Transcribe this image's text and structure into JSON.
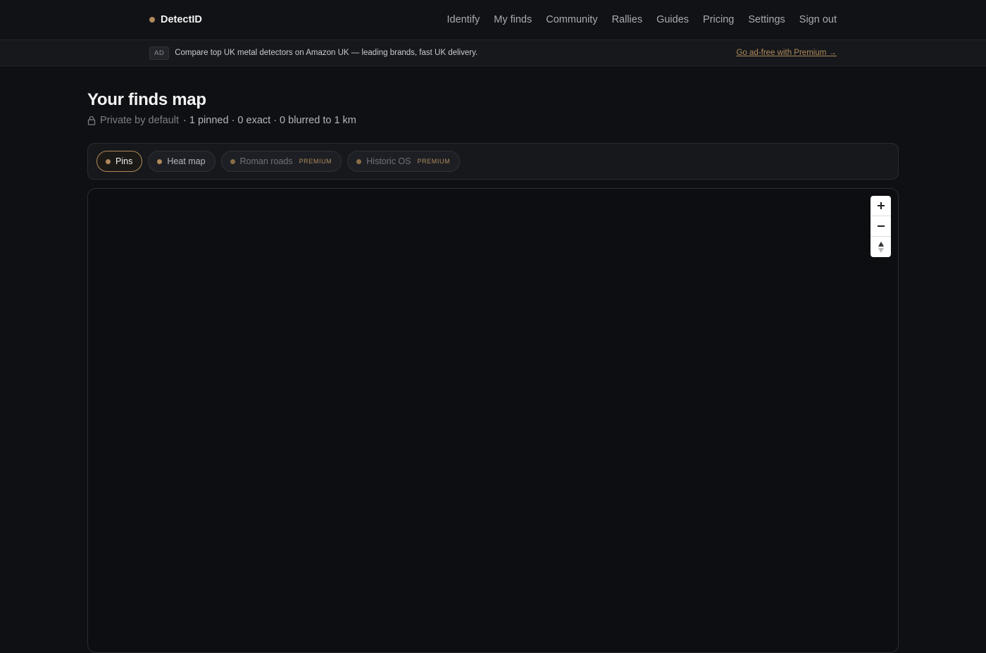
{
  "app": {
    "name": "DetectID",
    "brand_color": "#b08a5a"
  },
  "nav": {
    "items": [
      {
        "label": "Identify"
      },
      {
        "label": "My finds"
      },
      {
        "label": "Community"
      },
      {
        "label": "Rallies"
      },
      {
        "label": "Guides"
      },
      {
        "label": "Pricing"
      },
      {
        "label": "Settings"
      },
      {
        "label": "Sign out"
      }
    ]
  },
  "ad": {
    "badge": "AD",
    "text": "Compare top UK metal detectors on Amazon UK — leading brands, fast UK delivery.",
    "link": "Go ad-free with Premium →"
  },
  "page": {
    "title": "Your finds map",
    "privacy": "Private by default",
    "stats": "· 1 pinned · 0 exact · 0 blurred to 1 km"
  },
  "layers": {
    "chips": [
      {
        "label": "Pins",
        "active": true,
        "premium": ""
      },
      {
        "label": "Heat map",
        "active": false,
        "premium": ""
      },
      {
        "label": "Roman roads",
        "active": false,
        "premium": "PREMIUM"
      },
      {
        "label": "Historic OS",
        "active": false,
        "premium": "PREMIUM"
      }
    ]
  },
  "map": {
    "controls": {
      "zoom_in": "plus-icon",
      "zoom_out": "minus-icon",
      "reset": "compass-icon"
    }
  }
}
